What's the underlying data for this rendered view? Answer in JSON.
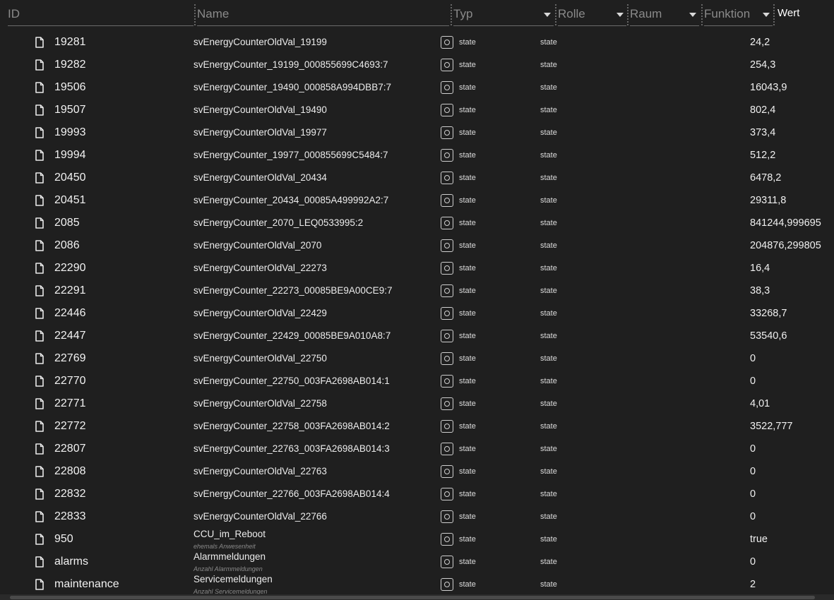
{
  "header": {
    "columns": [
      {
        "key": "id",
        "placeholder": "ID"
      },
      {
        "key": "name",
        "placeholder": "Name"
      },
      {
        "key": "typ",
        "placeholder": "Typ"
      },
      {
        "key": "rolle",
        "placeholder": "Rolle"
      },
      {
        "key": "raum",
        "placeholder": "Raum"
      },
      {
        "key": "funktion",
        "placeholder": "Funktion"
      }
    ],
    "wert_label": "Wert"
  },
  "icons": {
    "row_icon": "file-icon",
    "type_icon": "state-type-icon"
  },
  "rows": [
    {
      "id": "19281",
      "name": "svEnergyCounterOldVal_19199",
      "desc": "",
      "typ": "state",
      "rolle": "state",
      "wert": "24,2"
    },
    {
      "id": "19282",
      "name": "svEnergyCounter_19199_000855699C4693:7",
      "desc": "",
      "typ": "state",
      "rolle": "state",
      "wert": "254,3"
    },
    {
      "id": "19506",
      "name": "svEnergyCounter_19490_000858A994DBB7:7",
      "desc": "",
      "typ": "state",
      "rolle": "state",
      "wert": "16043,9"
    },
    {
      "id": "19507",
      "name": "svEnergyCounterOldVal_19490",
      "desc": "",
      "typ": "state",
      "rolle": "state",
      "wert": "802,4"
    },
    {
      "id": "19993",
      "name": "svEnergyCounterOldVal_19977",
      "desc": "",
      "typ": "state",
      "rolle": "state",
      "wert": "373,4"
    },
    {
      "id": "19994",
      "name": "svEnergyCounter_19977_000855699C5484:7",
      "desc": "",
      "typ": "state",
      "rolle": "state",
      "wert": "512,2"
    },
    {
      "id": "20450",
      "name": "svEnergyCounterOldVal_20434",
      "desc": "",
      "typ": "state",
      "rolle": "state",
      "wert": "6478,2"
    },
    {
      "id": "20451",
      "name": "svEnergyCounter_20434_00085A499992A2:7",
      "desc": "",
      "typ": "state",
      "rolle": "state",
      "wert": "29311,8"
    },
    {
      "id": "2085",
      "name": "svEnergyCounter_2070_LEQ0533995:2",
      "desc": "",
      "typ": "state",
      "rolle": "state",
      "wert": "841244,999695"
    },
    {
      "id": "2086",
      "name": "svEnergyCounterOldVal_2070",
      "desc": "",
      "typ": "state",
      "rolle": "state",
      "wert": "204876,299805"
    },
    {
      "id": "22290",
      "name": "svEnergyCounterOldVal_22273",
      "desc": "",
      "typ": "state",
      "rolle": "state",
      "wert": "16,4"
    },
    {
      "id": "22291",
      "name": "svEnergyCounter_22273_00085BE9A00CE9:7",
      "desc": "",
      "typ": "state",
      "rolle": "state",
      "wert": "38,3"
    },
    {
      "id": "22446",
      "name": "svEnergyCounterOldVal_22429",
      "desc": "",
      "typ": "state",
      "rolle": "state",
      "wert": "33268,7"
    },
    {
      "id": "22447",
      "name": "svEnergyCounter_22429_00085BE9A010A8:7",
      "desc": "",
      "typ": "state",
      "rolle": "state",
      "wert": "53540,6"
    },
    {
      "id": "22769",
      "name": "svEnergyCounterOldVal_22750",
      "desc": "",
      "typ": "state",
      "rolle": "state",
      "wert": "0"
    },
    {
      "id": "22770",
      "name": "svEnergyCounter_22750_003FA2698AB014:1",
      "desc": "",
      "typ": "state",
      "rolle": "state",
      "wert": "0"
    },
    {
      "id": "22771",
      "name": "svEnergyCounterOldVal_22758",
      "desc": "",
      "typ": "state",
      "rolle": "state",
      "wert": "4,01"
    },
    {
      "id": "22772",
      "name": "svEnergyCounter_22758_003FA2698AB014:2",
      "desc": "",
      "typ": "state",
      "rolle": "state",
      "wert": "3522,777"
    },
    {
      "id": "22807",
      "name": "svEnergyCounter_22763_003FA2698AB014:3",
      "desc": "",
      "typ": "state",
      "rolle": "state",
      "wert": "0"
    },
    {
      "id": "22808",
      "name": "svEnergyCounterOldVal_22763",
      "desc": "",
      "typ": "state",
      "rolle": "state",
      "wert": "0"
    },
    {
      "id": "22832",
      "name": "svEnergyCounter_22766_003FA2698AB014:4",
      "desc": "",
      "typ": "state",
      "rolle": "state",
      "wert": "0"
    },
    {
      "id": "22833",
      "name": "svEnergyCounterOldVal_22766",
      "desc": "",
      "typ": "state",
      "rolle": "state",
      "wert": "0"
    },
    {
      "id": "950",
      "name": "CCU_im_Reboot",
      "desc": "ehemals Anwesenheit",
      "typ": "state",
      "rolle": "state",
      "wert": "true"
    },
    {
      "id": "alarms",
      "name": "Alarmmeldungen",
      "desc": "Anzahl Alarmmeldungen",
      "typ": "state",
      "rolle": "state",
      "wert": "0"
    },
    {
      "id": "maintenance",
      "name": "Servicemeldungen",
      "desc": "Anzahl Servicemeldungen",
      "typ": "state",
      "rolle": "state",
      "wert": "2"
    }
  ]
}
